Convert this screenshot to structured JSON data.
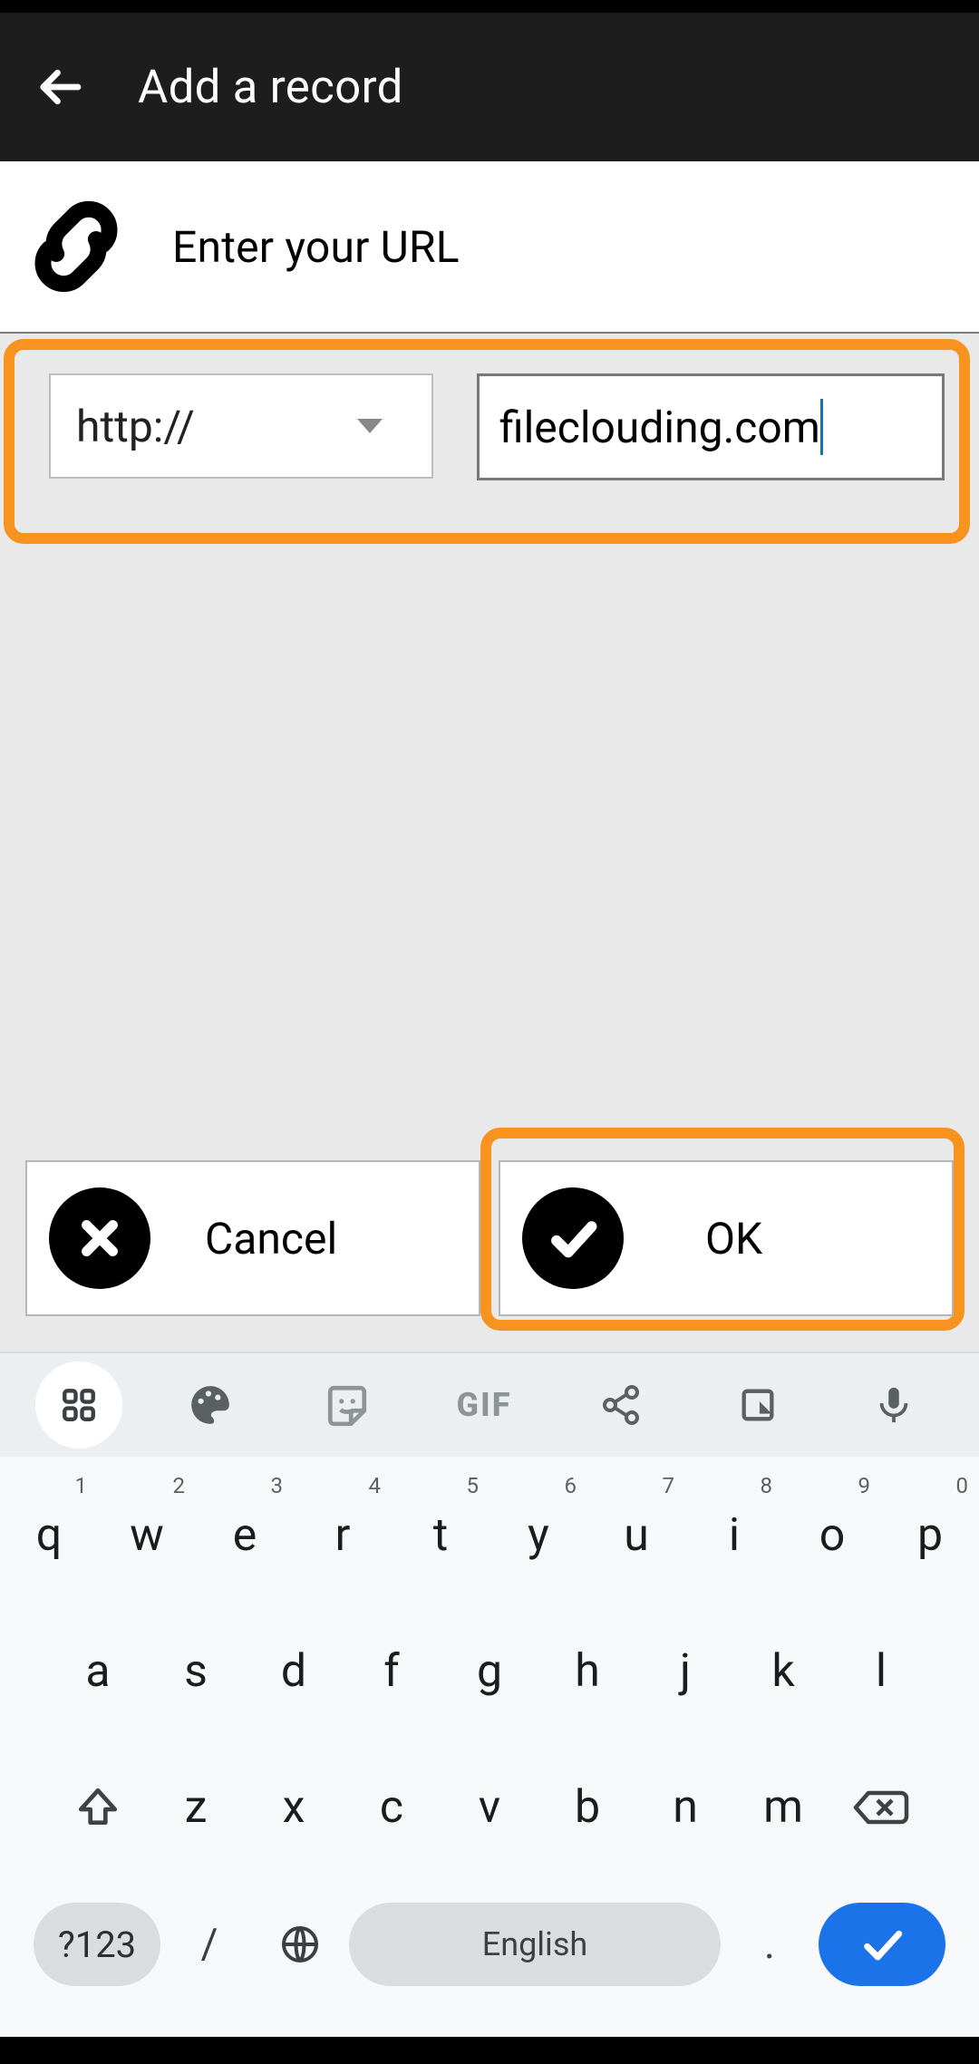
{
  "header": {
    "title": "Add a record"
  },
  "url_section": {
    "label": "Enter your URL"
  },
  "form": {
    "protocol_selected": "http://",
    "url_value": "fileclouding.com"
  },
  "buttons": {
    "cancel": "Cancel",
    "ok": "OK"
  },
  "colors": {
    "highlight": "#f7931e",
    "enter_key": "#1a73e8"
  },
  "keyboard": {
    "tools": [
      "apps",
      "palette",
      "sticker",
      "GIF",
      "share",
      "clipboard",
      "mic"
    ],
    "row1": [
      {
        "k": "q",
        "n": "1"
      },
      {
        "k": "w",
        "n": "2"
      },
      {
        "k": "e",
        "n": "3"
      },
      {
        "k": "r",
        "n": "4"
      },
      {
        "k": "t",
        "n": "5"
      },
      {
        "k": "y",
        "n": "6"
      },
      {
        "k": "u",
        "n": "7"
      },
      {
        "k": "i",
        "n": "8"
      },
      {
        "k": "o",
        "n": "9"
      },
      {
        "k": "p",
        "n": "0"
      }
    ],
    "row2": [
      "a",
      "s",
      "d",
      "f",
      "g",
      "h",
      "j",
      "k",
      "l"
    ],
    "row3": [
      "z",
      "x",
      "c",
      "v",
      "b",
      "n",
      "m"
    ],
    "symbols_key": "?123",
    "slash_key": "/",
    "language": "English",
    "period_key": "."
  }
}
